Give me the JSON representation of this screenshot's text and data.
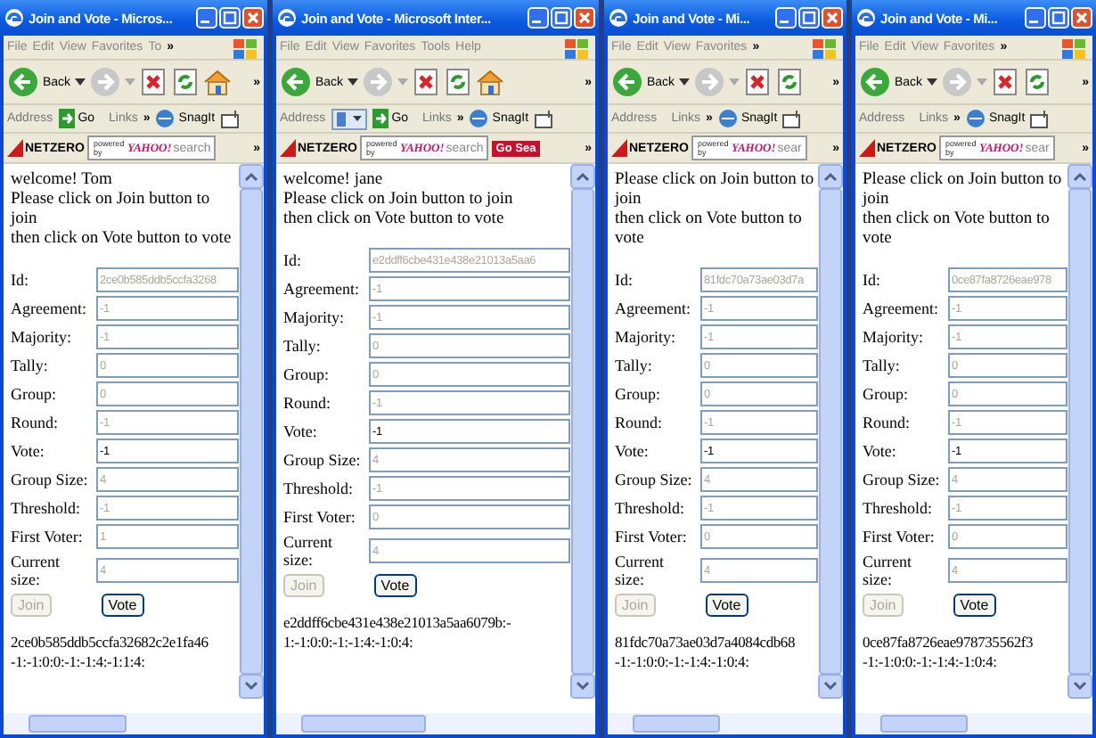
{
  "windows": [
    {
      "title": "Join and Vote - Micros...",
      "menu": [
        "File",
        "Edit",
        "View",
        "Favorites",
        "To"
      ],
      "menu_more": "»",
      "toolbar": {
        "back": "Back",
        "buttons": [
          {
            "kind": "stop"
          },
          {
            "kind": "refresh"
          },
          {
            "kind": "home"
          }
        ],
        "more": "»"
      },
      "address_bar": {
        "label": "Address",
        "go": "Go",
        "links": "Links",
        "more": "»",
        "snagit": "SnagIt"
      },
      "search_bar": {
        "logo": "NETZERO",
        "powered_by": "powered by",
        "brand": "YAHOO!",
        "search": "search",
        "more": "»"
      },
      "greeting": "welcome! Tom",
      "instructions": [
        "Please click on Join button to join",
        "then click on Vote button to vote"
      ],
      "fields": [
        {
          "label": "Id:",
          "value": "2ce0b585ddb5ccfa3268",
          "disabled": true
        },
        {
          "label": "Agreement:",
          "value": "-1",
          "disabled": true
        },
        {
          "label": "Majority:",
          "value": "-1",
          "disabled": true
        },
        {
          "label": "Tally:",
          "value": "0",
          "disabled": true
        },
        {
          "label": "Group:",
          "value": "0",
          "disabled": true
        },
        {
          "label": "Round:",
          "value": "-1",
          "disabled": true
        },
        {
          "label": "Vote:",
          "value": "-1",
          "disabled": false
        },
        {
          "label": "Group Size:",
          "value": "4",
          "disabled": true
        },
        {
          "label": "Threshold:",
          "value": "-1",
          "disabled": true
        },
        {
          "label": "First Voter:",
          "value": "1",
          "disabled": true
        },
        {
          "label": "Current size:",
          "value": "4",
          "disabled": true
        }
      ],
      "buttons": [
        {
          "label": "Join",
          "disabled": true
        },
        {
          "label": "Vote",
          "disabled": false
        }
      ],
      "output": [
        "2ce0b585ddb5ccfa32682c2e1fa46",
        "-1:-1:0:0:-1:-1:4:-1:1:4:"
      ]
    },
    {
      "title": "Join and Vote - Microsoft Inter...",
      "menu": [
        "File",
        "Edit",
        "View",
        "Favorites",
        "Tools",
        "Help"
      ],
      "toolbar": {
        "back": "Back",
        "buttons": [
          {
            "kind": "stop"
          },
          {
            "kind": "refresh"
          },
          {
            "kind": "home"
          }
        ],
        "more": "»"
      },
      "address_bar": {
        "label": "Address",
        "page_icon": true,
        "go": "Go",
        "links": "Links",
        "more": "»",
        "snagit": "SnagIt"
      },
      "search_bar": {
        "logo": "NETZERO",
        "powered_by": "powered by",
        "brand": "YAHOO!",
        "search": "search",
        "button": "Go Sea",
        "more": "»"
      },
      "greeting": "welcome! jane",
      "instructions": [
        "Please click on Join button to join",
        "then click on Vote button to vote"
      ],
      "fields": [
        {
          "label": "Id:",
          "value": "e2ddff6cbe431e438e21013a5aa6",
          "disabled": true
        },
        {
          "label": "Agreement:",
          "value": "-1",
          "disabled": true
        },
        {
          "label": "Majority:",
          "value": "-1",
          "disabled": true
        },
        {
          "label": "Tally:",
          "value": "0",
          "disabled": true
        },
        {
          "label": "Group:",
          "value": "0",
          "disabled": true
        },
        {
          "label": "Round:",
          "value": "-1",
          "disabled": true
        },
        {
          "label": "Vote:",
          "value": "-1",
          "disabled": false
        },
        {
          "label": "Group Size:",
          "value": "4",
          "disabled": true
        },
        {
          "label": "Threshold:",
          "value": "-1",
          "disabled": true
        },
        {
          "label": "First Voter:",
          "value": "0",
          "disabled": true
        },
        {
          "label": "Current size:",
          "value": "4",
          "disabled": true
        }
      ],
      "buttons": [
        {
          "label": "Join",
          "disabled": true
        },
        {
          "label": "Vote",
          "disabled": false
        }
      ],
      "output": [
        "e2ddff6cbe431e438e21013a5aa6079b:-",
        "1:-1:0:0:-1:-1:4:-1:0:4:"
      ]
    },
    {
      "title": "Join and Vote - Mi...",
      "menu": [
        "File",
        "Edit",
        "View",
        "Favorites"
      ],
      "menu_more": "»",
      "toolbar": {
        "back": "Back",
        "buttons": [
          {
            "kind": "stop"
          },
          {
            "kind": "refresh"
          }
        ],
        "more": "»"
      },
      "address_bar": {
        "label": "Address",
        "links": "Links",
        "more": "»",
        "snagit": "SnagIt"
      },
      "search_bar": {
        "logo": "NETZERO",
        "powered_by": "powered by",
        "brand": "YAHOO!",
        "search": "sear",
        "more": "»"
      },
      "instructions": [
        "Please click on Join button to join",
        "then click on Vote button to vote"
      ],
      "fields": [
        {
          "label": "Id:",
          "value": "81fdc70a73ae03d7a",
          "disabled": true
        },
        {
          "label": "Agreement:",
          "value": "-1",
          "disabled": true
        },
        {
          "label": "Majority:",
          "value": "-1",
          "disabled": true
        },
        {
          "label": "Tally:",
          "value": "0",
          "disabled": true
        },
        {
          "label": "Group:",
          "value": "0",
          "disabled": true
        },
        {
          "label": "Round:",
          "value": "-1",
          "disabled": true
        },
        {
          "label": "Vote:",
          "value": "-1",
          "disabled": false
        },
        {
          "label": "Group Size:",
          "value": "4",
          "disabled": true
        },
        {
          "label": "Threshold:",
          "value": "-1",
          "disabled": true
        },
        {
          "label": "First Voter:",
          "value": "0",
          "disabled": true
        },
        {
          "label": "Current size:",
          "value": "4",
          "disabled": true
        }
      ],
      "buttons": [
        {
          "label": "Join",
          "disabled": true
        },
        {
          "label": "Vote",
          "disabled": false
        }
      ],
      "output": [
        "81fdc70a73ae03d7a4084cdb68",
        "-1:-1:0:0:-1:-1:4:-1:0:4:"
      ]
    },
    {
      "title": "Join and Vote - Mi...",
      "menu": [
        "File",
        "Edit",
        "View",
        "Favorites"
      ],
      "menu_more": "»",
      "toolbar": {
        "back": "Back",
        "buttons": [
          {
            "kind": "stop"
          },
          {
            "kind": "refresh"
          }
        ],
        "more": "»"
      },
      "address_bar": {
        "label": "Address",
        "links": "Links",
        "more": "»",
        "snagit": "SnagIt"
      },
      "search_bar": {
        "logo": "NETZERO",
        "powered_by": "powered by",
        "brand": "YAHOO!",
        "search": "sear",
        "more": "»"
      },
      "instructions": [
        "Please click on Join button to join",
        "then click on Vote button to vote"
      ],
      "fields": [
        {
          "label": "Id:",
          "value": "0ce87fa8726eae978",
          "disabled": true
        },
        {
          "label": "Agreement:",
          "value": "-1",
          "disabled": true
        },
        {
          "label": "Majority:",
          "value": "-1",
          "disabled": true
        },
        {
          "label": "Tally:",
          "value": "0",
          "disabled": true
        },
        {
          "label": "Group:",
          "value": "0",
          "disabled": true
        },
        {
          "label": "Round:",
          "value": "-1",
          "disabled": true
        },
        {
          "label": "Vote:",
          "value": "-1",
          "disabled": false
        },
        {
          "label": "Group Size:",
          "value": "4",
          "disabled": true
        },
        {
          "label": "Threshold:",
          "value": "-1",
          "disabled": true
        },
        {
          "label": "First Voter:",
          "value": "0",
          "disabled": true
        },
        {
          "label": "Current size:",
          "value": "4",
          "disabled": true
        }
      ],
      "buttons": [
        {
          "label": "Join",
          "disabled": true
        },
        {
          "label": "Vote",
          "disabled": false
        }
      ],
      "output": [
        "0ce87fa8726eae978735562f3",
        "-1:-1:0:0:-1:-1:4:-1:0:4:"
      ]
    }
  ]
}
